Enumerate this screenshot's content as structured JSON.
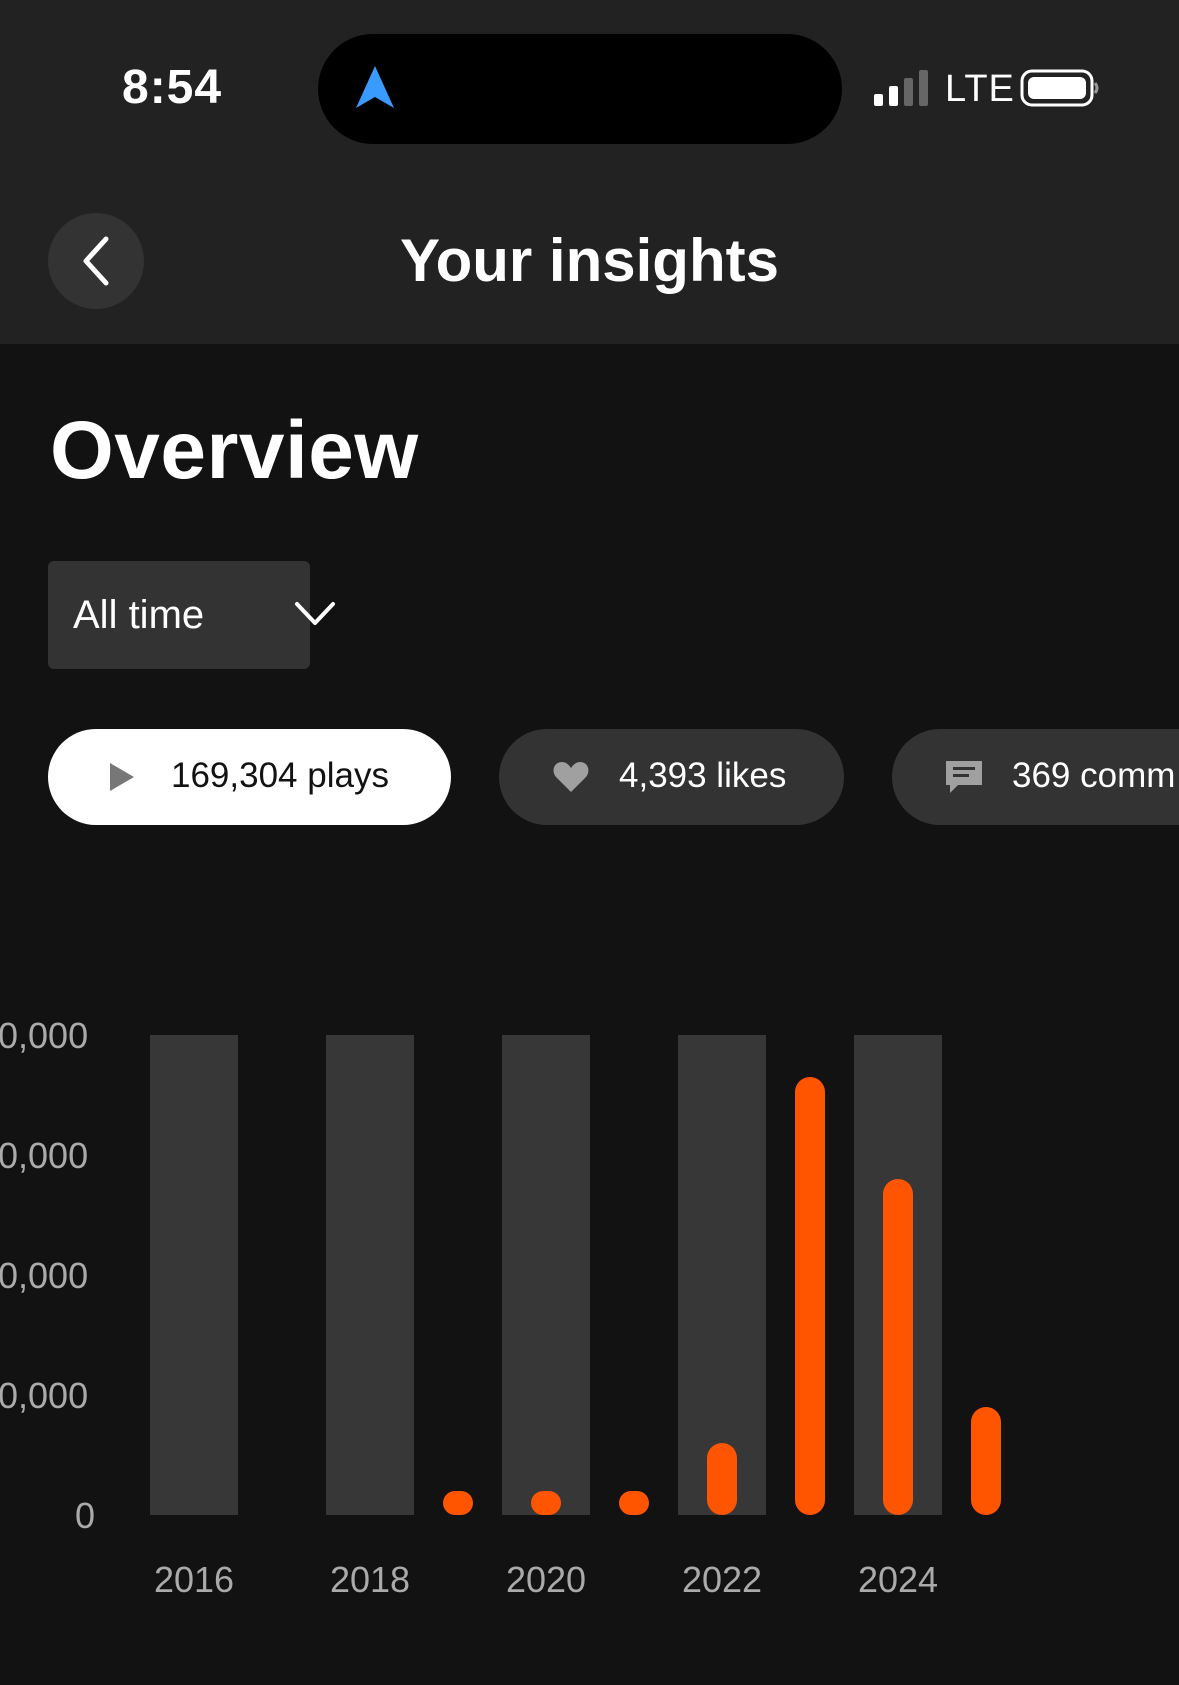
{
  "status_bar": {
    "time": "8:54",
    "network": "LTE",
    "icons": [
      "navigation-arrow-icon",
      "signal-icon",
      "battery-icon"
    ]
  },
  "header": {
    "title": "Your insights",
    "back_icon": "chevron-left-icon"
  },
  "overview": {
    "title": "Overview",
    "filter": {
      "selected": "All time",
      "icon": "chevron-down-icon"
    }
  },
  "metrics": [
    {
      "label": "169,304 plays",
      "icon": "play-icon",
      "active": true
    },
    {
      "label": "4,393 likes",
      "icon": "heart-icon",
      "active": false
    },
    {
      "label": "369 comm",
      "icon": "comment-icon",
      "active": false
    }
  ],
  "colors": {
    "accent": "#ff5500",
    "background": "#121212",
    "surface": "#222222",
    "chip": "#333333",
    "bar_track": "#373737"
  },
  "chart_data": {
    "type": "bar",
    "categories": [
      "2016",
      "2017",
      "2018",
      "2019",
      "2020",
      "2021",
      "2022",
      "2023",
      "2024",
      "2025"
    ],
    "x_tick_labels": [
      "2016",
      "2018",
      "2020",
      "2022",
      "2024"
    ],
    "y_tick_labels": [
      "0,000",
      "0,000",
      "0,000",
      "0,000",
      "0"
    ],
    "ylim": [
      0,
      80000
    ],
    "values": [
      0,
      0,
      0,
      1000,
      3000,
      4000,
      12000,
      73000,
      56000,
      18000
    ],
    "highlighted_years": [
      "2016",
      "2018",
      "2020",
      "2022",
      "2024"
    ],
    "grid": false,
    "legend": "none"
  }
}
